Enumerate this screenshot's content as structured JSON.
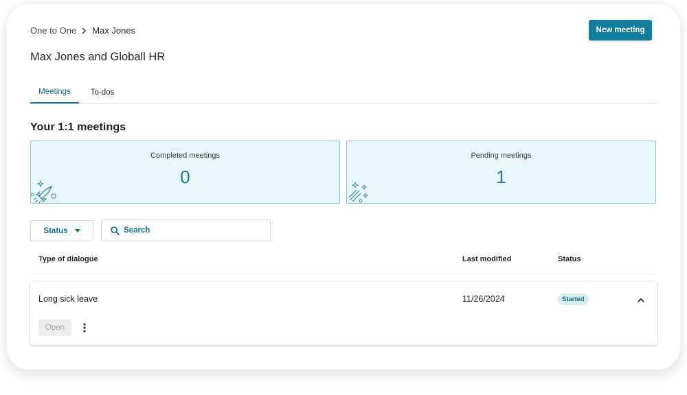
{
  "breadcrumb": {
    "parent": "One to One",
    "current": "Max Jones"
  },
  "header": {
    "new_meeting_label": "New meeting"
  },
  "page_title": "Max Jones and Globall HR",
  "tabs": [
    {
      "label": "Meetings",
      "active": true
    },
    {
      "label": "To-dos",
      "active": false
    }
  ],
  "section_title": "Your 1:1 meetings",
  "stats": {
    "completed": {
      "label": "Completed meetings",
      "value": "0",
      "icon": "rocket-icon"
    },
    "pending": {
      "label": "Pending meetings",
      "value": "1",
      "icon": "sparkle-icon"
    }
  },
  "filters": {
    "status_label": "Status",
    "search_placeholder": "Search",
    "search_value": ""
  },
  "table": {
    "headers": {
      "type": "Type of dialogue",
      "modified": "Last modified",
      "status": "Status"
    },
    "rows": [
      {
        "type": "Long sick leave",
        "modified": "11/26/2024",
        "status": "Started",
        "open_label": "Open",
        "expanded": true
      }
    ]
  },
  "colors": {
    "primary": "#0f7d9b",
    "card_bg": "#e7f6f9",
    "card_border": "#8ccadb",
    "badge_bg": "#d4ecf2"
  }
}
